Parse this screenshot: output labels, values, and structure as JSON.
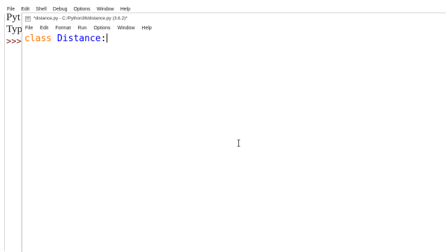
{
  "shell": {
    "menu": [
      "File",
      "Edit",
      "Shell",
      "Debug",
      "Options",
      "Window",
      "Help"
    ],
    "lines": [
      "Pyt",
      "Typ"
    ],
    "prompt": ">>>"
  },
  "editor": {
    "title": "*distance.py - C:/Python36/distance.py (3.6.2)*",
    "menu": [
      "File",
      "Edit",
      "Format",
      "Run",
      "Options",
      "Window",
      "Help"
    ],
    "code": {
      "keyword": "class",
      "name": "Distance",
      "punct": ":"
    }
  },
  "colors": {
    "keyword": "#ff7700",
    "definition": "#0000ff"
  },
  "icons": {
    "editor_app": "python-idle-icon",
    "cursor": "text-ibeam-cursor"
  }
}
